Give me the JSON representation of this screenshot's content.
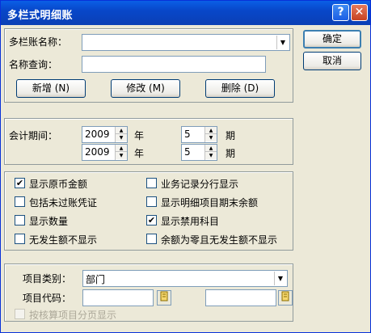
{
  "window": {
    "title": "多栏式明细账",
    "help_glyph": "?",
    "close_glyph": "✕"
  },
  "account": {
    "name_label": "多栏账名称：",
    "name_value": "",
    "query_label": "名称查询：",
    "query_value": "",
    "add_label": "新增 (N)",
    "modify_label": "修改 (M)",
    "delete_label": "删除 (D)"
  },
  "actions": {
    "ok_label": "确定",
    "cancel_label": "取消"
  },
  "period": {
    "label": "会计期间：",
    "year_unit": "年",
    "period_unit": "期",
    "start_year": "2009",
    "start_period": "5",
    "end_year": "2009",
    "end_period": "5"
  },
  "options": [
    {
      "label": "显示原币金额",
      "checked": true
    },
    {
      "label": "业务记录分行显示",
      "checked": false
    },
    {
      "label": "包括未过账凭证",
      "checked": false
    },
    {
      "label": "显示明细项目期末余额",
      "checked": false
    },
    {
      "label": "显示数量",
      "checked": false
    },
    {
      "label": "显示禁用科目",
      "checked": true
    },
    {
      "label": "无发生额不显示",
      "checked": false
    },
    {
      "label": "余额为零且无发生额不显示",
      "checked": false
    }
  ],
  "project": {
    "category_label": "项目类别：",
    "category_value": "部门",
    "code_label": "项目代码：",
    "code_from": "",
    "code_to": "",
    "paging_label": "按核算项目分页显示",
    "paging_checked": false
  },
  "glyphs": {
    "check": "✔",
    "arrow_down": "▼",
    "arrow_up": "▲"
  }
}
